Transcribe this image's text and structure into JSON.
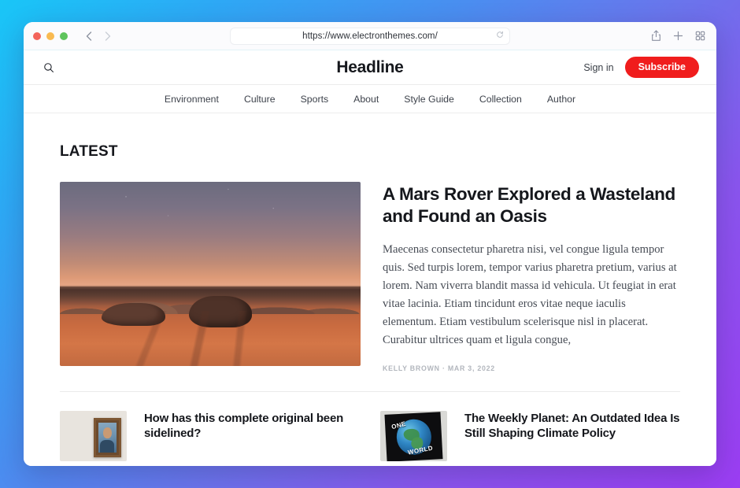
{
  "browser": {
    "url": "https://www.electronthemes.com/",
    "back_label": "‹",
    "forward_label": "›",
    "reload_label": "⟳",
    "share_label": "share-icon",
    "new_tab_label": "+",
    "tabs_label": "tabs-icon"
  },
  "site": {
    "title": "Headline",
    "search_label": "Search",
    "signin_label": "Sign in",
    "subscribe_label": "Subscribe",
    "accent_color": "#f01d1d",
    "nav": [
      {
        "label": "Environment"
      },
      {
        "label": "Culture"
      },
      {
        "label": "Sports"
      },
      {
        "label": "About"
      },
      {
        "label": "Style Guide"
      },
      {
        "label": "Collection"
      },
      {
        "label": "Author"
      }
    ],
    "section_heading": "LATEST",
    "featured": {
      "headline": "A Mars Rover Explored a Wasteland and Found an Oasis",
      "excerpt": "Maecenas consectetur pharetra nisi, vel congue ligula tempor quis. Sed turpis lorem, tempor varius pharetra pretium, varius at lorem. Nam viverra blandit massa id vehicula. Ut feugiat in erat vitae lacinia. Etiam tincidunt eros vitae neque iaculis elementum. Etiam vestibulum scelerisque nisl in placerat. Curabitur ultrices quam et ligula congue,",
      "author": "KELLY BROWN",
      "separator": "·",
      "date": "MAR 3, 2022",
      "meta": "KELLY BROWN · MAR 3, 2022",
      "image_alt": "mars-desert-landscape-at-dusk"
    },
    "cards": [
      {
        "title": "How has this complete original been sidelined?",
        "meta": "",
        "thumb_alt": "framed-portrait-painting"
      },
      {
        "title": "The Weekly Planet: An Outdated Idea Is Still Shaping Climate Policy",
        "meta": "",
        "thumb_alt": "one-world-globe-poster"
      }
    ]
  },
  "globe_poster": {
    "word_one": "ONE",
    "word_world": "WORLD"
  }
}
